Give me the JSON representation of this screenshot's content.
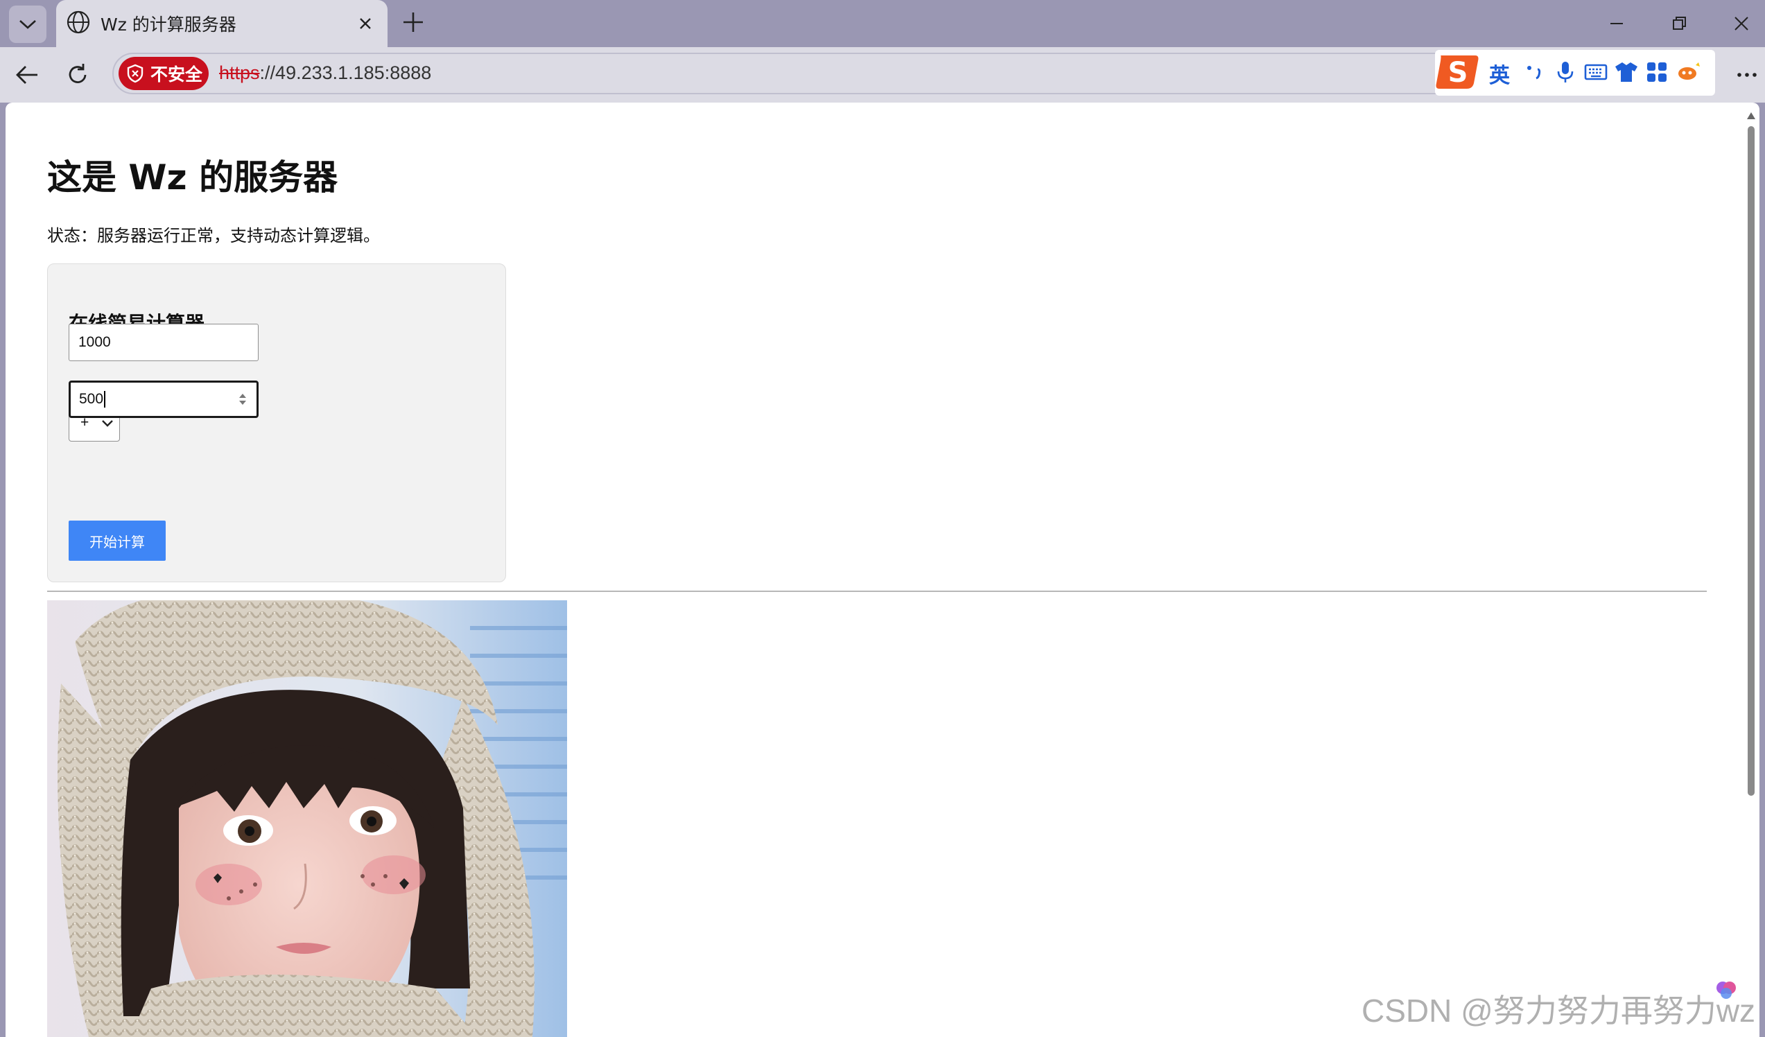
{
  "browser": {
    "tab_title": "Wz 的计算服务器",
    "security_label": "不安全",
    "url_scheme": "https",
    "url_rest": "://49.233.1.185:8888",
    "ime_lang": "英"
  },
  "page": {
    "title": "这是 Wz 的服务器",
    "status": "状态：服务器运行正常，支持动态计算逻辑。",
    "calculator": {
      "heading": "在线简易计算器",
      "first_value": "1000",
      "operator": "+",
      "second_value": "500",
      "submit_label": "开始计算"
    }
  },
  "watermark": "CSDN @努力努力再努力wz",
  "colors": {
    "tabstrip": "#9a97b3",
    "insecure_badge": "#c8101e",
    "button": "#3f86f6",
    "card": "#f2f2f2"
  }
}
